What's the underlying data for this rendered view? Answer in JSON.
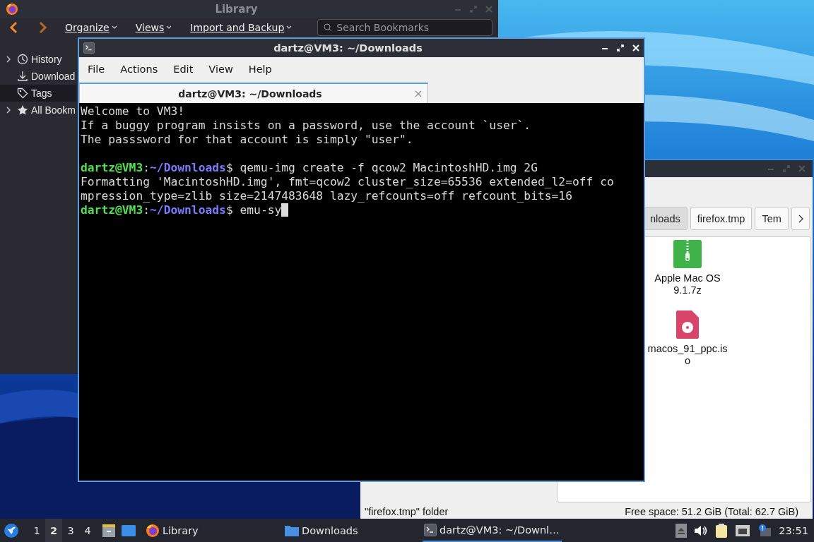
{
  "library": {
    "title": "Library",
    "toolbar": [
      "Organize",
      "Views",
      "Import and Backup"
    ],
    "search": {
      "placeholder": "Search Bookmarks"
    },
    "sidebar": [
      {
        "label": "History",
        "expandable": true,
        "selected": false
      },
      {
        "label": "Download",
        "expandable": false,
        "selected": false
      },
      {
        "label": "Tags",
        "expandable": false,
        "selected": true
      },
      {
        "label": "All Bookm",
        "expandable": true,
        "selected": false
      }
    ]
  },
  "terminal": {
    "title": "dartz@VM3: ~/Downloads",
    "menu": [
      "File",
      "Actions",
      "Edit",
      "View",
      "Help"
    ],
    "tabs": [
      {
        "label": "dartz@VM3: ~/Downloads",
        "selected": true
      }
    ],
    "lines": [
      {
        "kind": "text",
        "text": "Welcome to VM3!"
      },
      {
        "kind": "text",
        "text": "If a buggy program insists on a password, use the account `user`."
      },
      {
        "kind": "text",
        "text": "The passsword for that account is simply \"user\"."
      },
      {
        "kind": "blank"
      },
      {
        "kind": "prompt",
        "user": "dartz@VM3",
        "sep": ":",
        "path": "~/Downloads",
        "command": "$ qemu-img create -f qcow2 MacintoshHD.img 2G",
        "cursor": false
      },
      {
        "kind": "text",
        "text": "Formatting 'MacintoshHD.img', fmt=qcow2 cluster_size=65536 extended_l2=off co"
      },
      {
        "kind": "text",
        "text": "mpression_type=zlib size=2147483648 lazy_refcounts=off refcount_bits=16"
      },
      {
        "kind": "prompt",
        "user": "dartz@VM3",
        "sep": ":",
        "path": "~/Downloads",
        "command": "$ emu-sy",
        "cursor": true
      }
    ]
  },
  "file_manager": {
    "path_buttons": [
      {
        "label": "nloads",
        "selected": true
      },
      {
        "label": "firefox.tmp",
        "selected": false
      },
      {
        "label": "Tem",
        "selected": false
      }
    ],
    "files": [
      {
        "name": [
          "Apple Mac OS",
          "9.1.7z"
        ],
        "kind": "archive"
      },
      {
        "name": [
          "macos_91_ppc.is",
          "o"
        ],
        "kind": "disc"
      }
    ],
    "status": "\"firefox.tmp\" folder",
    "free_space": "Free space: 51.2 GiB (Total: 62.7 GiB)"
  },
  "taskbar": {
    "workspaces": [
      {
        "label": "1",
        "selected": false
      },
      {
        "label": "2",
        "selected": true
      },
      {
        "label": "3",
        "selected": false
      },
      {
        "label": "4",
        "selected": false
      }
    ],
    "tasks": [
      {
        "label": "Library",
        "kind": "browser",
        "selected": false
      },
      {
        "label": "Downloads",
        "kind": "folder",
        "selected": false
      },
      {
        "label": "dartz@VM3: ~/Downl…",
        "kind": "terminal",
        "selected": true
      }
    ],
    "clock": "23:51"
  }
}
